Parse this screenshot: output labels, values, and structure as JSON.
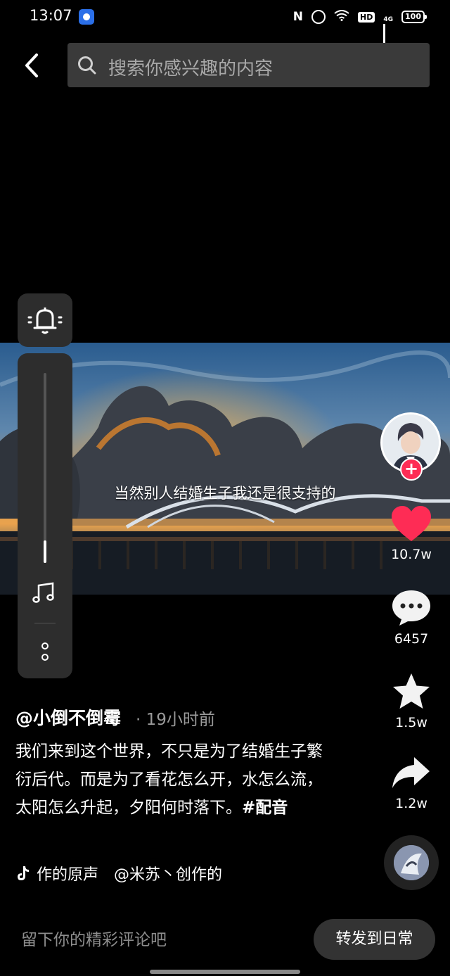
{
  "status_bar": {
    "time": "13:07",
    "network": "4G",
    "battery": "100",
    "hd_label": "HD",
    "nfc_label": "N"
  },
  "header": {
    "search_placeholder": "搜索你感兴趣的内容"
  },
  "video": {
    "subtitle": "当然别人结婚生子我还是很支持的"
  },
  "actions": {
    "likes": "10.7w",
    "comments": "6457",
    "favorites": "1.5w",
    "shares": "1.2w",
    "like_color": "#fe2c55"
  },
  "post": {
    "author": "@小倒不倒霉",
    "time_ago": "· 19小时前",
    "description": "我们来到这个世界，不只是为了结婚生子繁衍后代。而是为了看花怎么开，水怎么流，太阳怎么升起，夕阳何时落下。",
    "hashtag": "#配音",
    "music": "作的原声　@米苏丶创作的"
  },
  "bottom_bar": {
    "comment_placeholder": "留下你的精彩评论吧",
    "forward_label": "转发到日常"
  }
}
